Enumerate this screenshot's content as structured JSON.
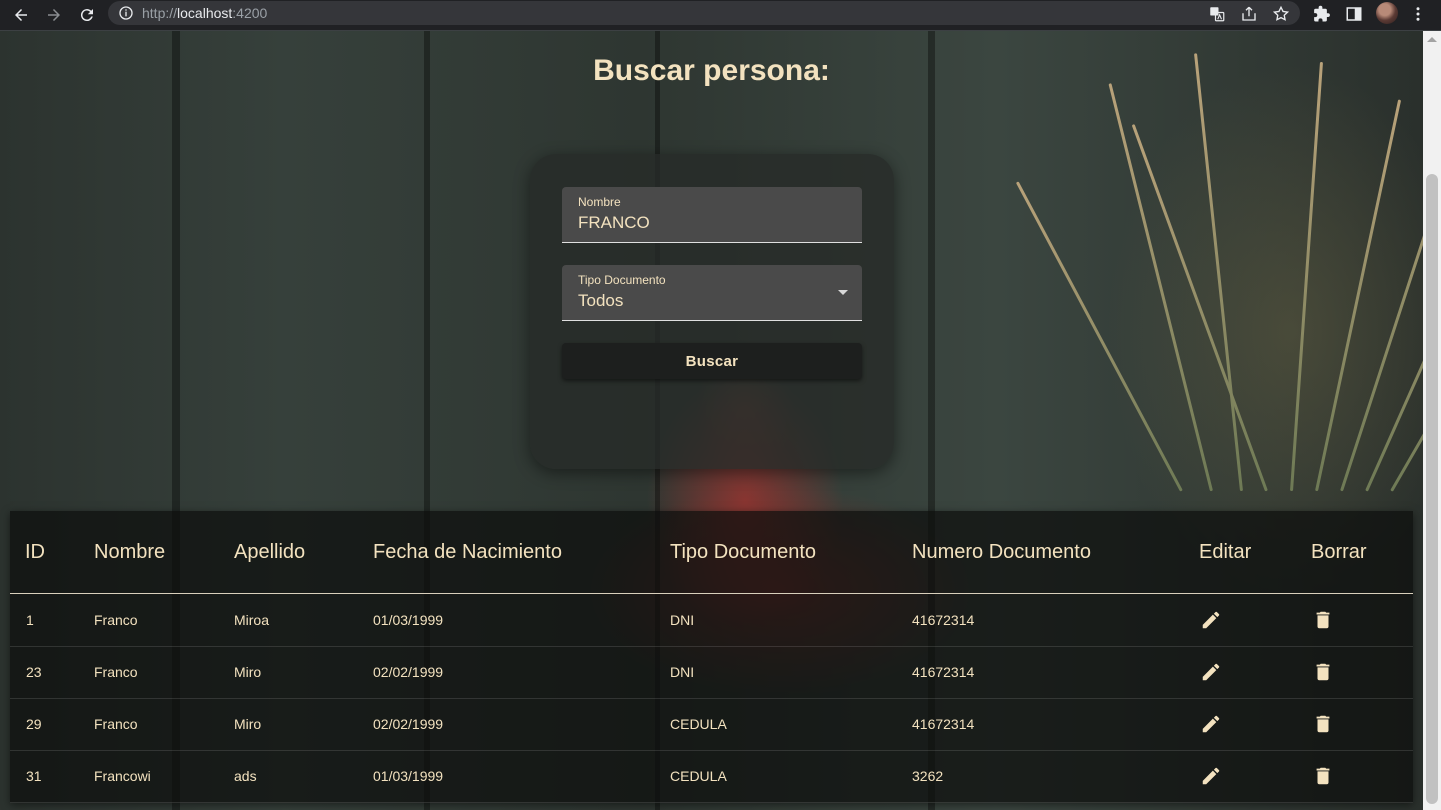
{
  "browser": {
    "url_scheme": "http://",
    "url_host": "localhost",
    "url_port": ":4200",
    "icons": [
      "back-icon",
      "forward-icon",
      "reload-icon",
      "site-info-icon",
      "translate-icon",
      "share-icon",
      "bookmark-star-icon",
      "extensions-icon",
      "side-panel-icon",
      "profile-avatar",
      "menu-dots-icon"
    ]
  },
  "page": {
    "title": "Buscar persona:"
  },
  "form": {
    "nombre_label": "Nombre",
    "nombre_value": "FRANCO",
    "tipo_label": "Tipo Documento",
    "tipo_value": "Todos",
    "search_button": "Buscar"
  },
  "table": {
    "headers": [
      "ID",
      "Nombre",
      "Apellido",
      "Fecha de Nacimiento",
      "Tipo Documento",
      "Numero Documento",
      "Editar",
      "Borrar"
    ],
    "rows": [
      {
        "id": "1",
        "nombre": "Franco",
        "apellido": "Miroa",
        "fecha": "01/03/1999",
        "tipo": "DNI",
        "numero": "41672314"
      },
      {
        "id": "23",
        "nombre": "Franco",
        "apellido": "Miro",
        "fecha": "02/02/1999",
        "tipo": "DNI",
        "numero": "41672314"
      },
      {
        "id": "29",
        "nombre": "Franco",
        "apellido": "Miro",
        "fecha": "02/02/1999",
        "tipo": "CEDULA",
        "numero": "41672314"
      },
      {
        "id": "31",
        "nombre": "Francowi",
        "apellido": "ads",
        "fecha": "01/03/1999",
        "tipo": "CEDULA",
        "numero": "3262"
      }
    ],
    "row_icons": {
      "edit": "pencil-icon",
      "delete": "trash-icon"
    }
  },
  "colors": {
    "accent_text": "#f3e2bf",
    "chrome_bg": "#202124",
    "field_bg": "#4a4a4a",
    "button_bg": "#1d1f1e"
  }
}
